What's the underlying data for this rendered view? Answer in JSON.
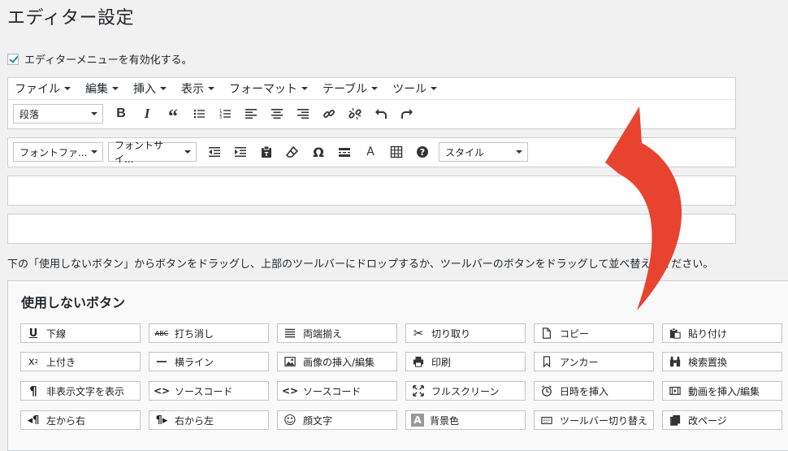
{
  "page_title": "エディター設定",
  "enable_menu_label": "エディターメニューを有効化する。",
  "menubar": [
    "ファイル",
    "編集",
    "挿入",
    "表示",
    "フォーマット",
    "テーブル",
    "ツール"
  ],
  "toolbar1": {
    "format_select": "段落"
  },
  "toolbar2": {
    "font_family": "フォントファ...",
    "font_size": "フォントサイ...",
    "char_sample": "A",
    "style_select": "スタイル"
  },
  "description": "下の「使用しないボタン」からボタンをドラッグし、上部のツールバーにドロップするか、ツールバーのボタンをドラッグして並べ替えてください。",
  "unused": {
    "title": "使用しないボタン",
    "buttons": [
      [
        "下線",
        "打ち消し",
        "両端揃え",
        "切り取り",
        "コピー",
        "貼り付け"
      ],
      [
        "上付き",
        "横ライン",
        "画像の挿入/編集",
        "印刷",
        "アンカー",
        "検索置換"
      ],
      [
        "非表示文字を表示",
        "ソースコード",
        "ソースコード",
        "フルスクリーン",
        "日時を挿入",
        "動画を挿入/編集"
      ],
      [
        "左から右",
        "右から左",
        "顔文字",
        "背景色",
        "ツールバー切り替え",
        "改ページ"
      ]
    ]
  },
  "colors": {
    "arrow": "#e8432f",
    "check": "#1e8cbe"
  }
}
